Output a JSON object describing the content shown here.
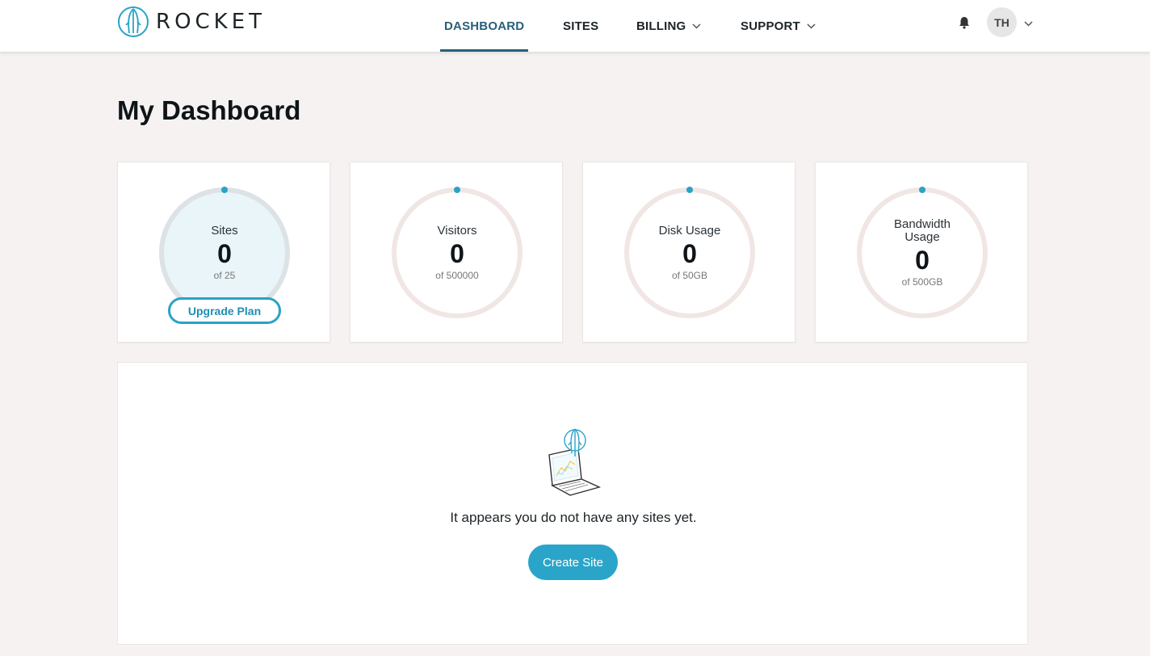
{
  "header": {
    "logo_text": "ROCKET",
    "nav": [
      {
        "label": "DASHBOARD",
        "active": true,
        "has_dropdown": false
      },
      {
        "label": "SITES",
        "active": false,
        "has_dropdown": false
      },
      {
        "label": "BILLING",
        "active": false,
        "has_dropdown": true
      },
      {
        "label": "SUPPORT",
        "active": false,
        "has_dropdown": true
      }
    ],
    "user_initials": "TH"
  },
  "page_title": "My Dashboard",
  "stats": [
    {
      "label": "Sites",
      "value": "0",
      "limit": "of 25"
    },
    {
      "label": "Visitors",
      "value": "0",
      "limit": "of 500000"
    },
    {
      "label": "Disk Usage",
      "value": "0",
      "limit": "of 50GB"
    },
    {
      "label": "Bandwidth Usage",
      "value": "0",
      "limit": "of 500GB"
    }
  ],
  "upgrade_label": "Upgrade Plan",
  "empty_state": {
    "message": "It appears you do not have any sites yet.",
    "create_label": "Create Site"
  },
  "colors": {
    "accent": "#2aa5c9",
    "nav_active": "#27607a",
    "ring_track": "#f0e6e4",
    "ring_sites": "#dde2e5",
    "sites_fill": "#e9f5f9"
  },
  "icons": {
    "logo": "rocket-logo-icon",
    "bell": "bell-icon",
    "chevron": "chevron-down-icon",
    "empty_illustration": "laptop-rocket-illustration"
  }
}
